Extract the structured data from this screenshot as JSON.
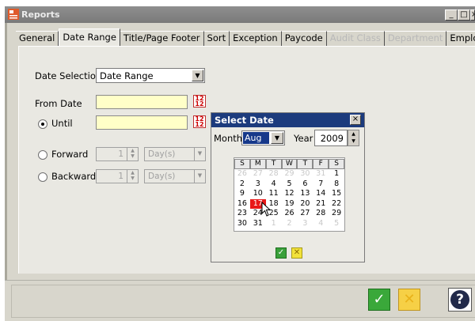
{
  "window": {
    "title": "Reports",
    "minimize": "_",
    "maximize": "□",
    "close": "×"
  },
  "tabs": [
    {
      "label": "General",
      "state": "normal"
    },
    {
      "label": "Date Range",
      "state": "active"
    },
    {
      "label": "Title/Page Footer",
      "state": "normal"
    },
    {
      "label": "Sort",
      "state": "normal"
    },
    {
      "label": "Exception",
      "state": "normal"
    },
    {
      "label": "Paycode",
      "state": "normal"
    },
    {
      "label": "Audit Class",
      "state": "disabled"
    },
    {
      "label": "Department",
      "state": "disabled"
    },
    {
      "label": "Employee",
      "state": "normal"
    }
  ],
  "form": {
    "date_selection_label": "Date Selection",
    "date_selection_value": "Date Range",
    "from_date_label": "From Date",
    "until_label": "Until",
    "forward_label": "Forward",
    "backward_label": "Backward",
    "forward_count": "1",
    "backward_count": "1",
    "forward_unit": "Day(s)",
    "backward_unit": "Day(s)",
    "selected_option": "until"
  },
  "select_date": {
    "title": "Select Date",
    "month_label": "Month",
    "month_value": "Aug",
    "year_label": "Year",
    "year_value": "2009",
    "weekdays": [
      "S",
      "M",
      "T",
      "W",
      "T",
      "F",
      "S"
    ],
    "weeks": [
      [
        "26",
        "27",
        "28",
        "29",
        "30",
        "31",
        "1"
      ],
      [
        "2",
        "3",
        "4",
        "5",
        "6",
        "7",
        "8"
      ],
      [
        "9",
        "10",
        "11",
        "12",
        "13",
        "14",
        "15"
      ],
      [
        "16",
        "17",
        "18",
        "19",
        "20",
        "21",
        "22"
      ],
      [
        "23",
        "24",
        "25",
        "26",
        "27",
        "28",
        "29"
      ],
      [
        "30",
        "31",
        "1",
        "2",
        "3",
        "4",
        "5"
      ]
    ],
    "selected_day": "17",
    "ok_glyph": "✓",
    "cancel_glyph": "✕"
  },
  "footer": {
    "ok_glyph": "✓",
    "cancel_glyph": "✕",
    "help_glyph": "?"
  },
  "colors": {
    "title_bar": "#8f8f8f",
    "popup_title": "#1c3b7d",
    "date_field": "#ffffc8",
    "selected_day": "#e81818",
    "ok_green": "#3aa83a",
    "cancel_yellow": "#f6d046"
  }
}
